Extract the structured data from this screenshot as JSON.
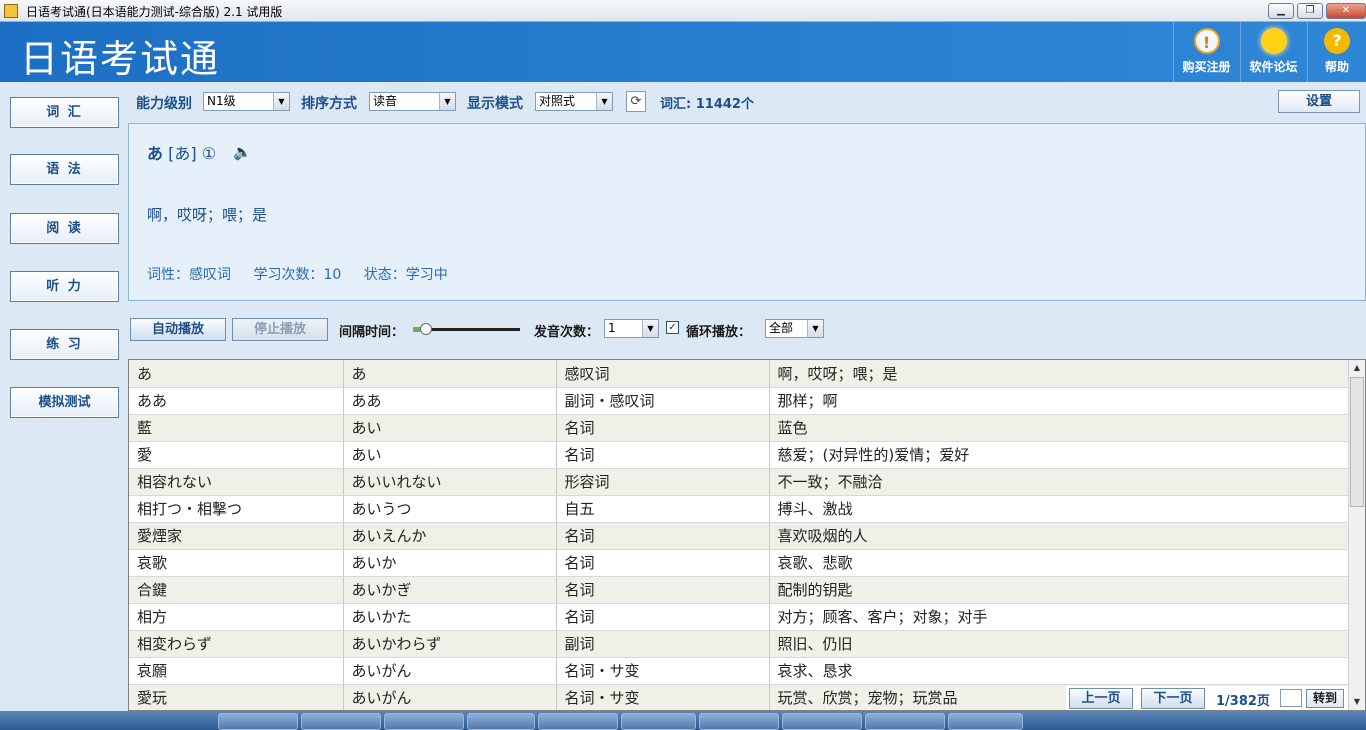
{
  "window": {
    "title": "日语考试通(日本语能力测试-综合版) 2.1 试用版",
    "buttons": {
      "minimize": "▁",
      "maximize": "❐",
      "close": "✕"
    }
  },
  "header": {
    "brand": "日语考试通",
    "buttons": [
      {
        "label": "购买注册",
        "icon": "register-icon",
        "glyph": "!"
      },
      {
        "label": "软件论坛",
        "icon": "lightbulb-icon",
        "glyph": "●"
      },
      {
        "label": "帮助",
        "icon": "help-icon",
        "glyph": "?"
      }
    ]
  },
  "sidebar": {
    "items": [
      {
        "label": "词  汇"
      },
      {
        "label": "语  法"
      },
      {
        "label": "阅  读"
      },
      {
        "label": "听  力"
      },
      {
        "label": "练  习"
      },
      {
        "label": "模拟测试"
      }
    ]
  },
  "toolbar": {
    "level_label": "能力级别",
    "level_value": "N1级",
    "sort_label": "排序方式",
    "sort_value": "读音",
    "mode_label": "显示模式",
    "mode_value": "对照式",
    "refresh_glyph": "⟳",
    "vocab_count": "词汇: 11442个",
    "settings_label": "设置"
  },
  "detail": {
    "word": "あ",
    "reading": "[あ]",
    "accent": "①",
    "speaker_glyph": "🔈",
    "meaning": "啊，哎呀；喂；是",
    "pos": "词性：感叹词",
    "study_count": "学习次数：10",
    "status": "状态：学习中"
  },
  "playback": {
    "auto_play": "自动播放",
    "stop_play": "停止播放",
    "interval_label": "间隔时间：",
    "interval_level": 0.12,
    "repeat_label": "发音次数：",
    "repeat_value": "1",
    "loop_checked_glyph": "✓",
    "loop_label": "循环播放：",
    "loop_value": "全部"
  },
  "words": [
    [
      "あ",
      "あ",
      "感叹词",
      "啊，哎呀；喂；是"
    ],
    [
      "ああ",
      "ああ",
      "副词・感叹词",
      "那样；啊"
    ],
    [
      "藍",
      "あい",
      "名词",
      "蓝色"
    ],
    [
      "愛",
      "あい",
      "名词",
      "慈爱；(对异性的)爱情；爱好"
    ],
    [
      "相容れない",
      "あいいれない",
      "形容词",
      "不一致；不融洽"
    ],
    [
      "相打つ・相撃つ",
      "あいうつ",
      "自五",
      "搏斗、激战"
    ],
    [
      "愛煙家",
      "あいえんか",
      "名词",
      "喜欢吸烟的人"
    ],
    [
      "哀歌",
      "あいか",
      "名词",
      "哀歌、悲歌"
    ],
    [
      "合鍵",
      "あいかぎ",
      "名词",
      "配制的钥匙"
    ],
    [
      "相方",
      "あいかた",
      "名词",
      "对方；顾客、客户；对象；对手"
    ],
    [
      "相変わらず",
      "あいかわらず",
      "副词",
      "照旧、仍旧"
    ],
    [
      "哀願",
      "あいがん",
      "名词・サ变",
      "哀求、恳求"
    ],
    [
      "愛玩",
      "あいがん",
      "名词・サ变",
      "玩赏、欣赏；宠物；玩赏品"
    ]
  ],
  "pager": {
    "prev": "上一页",
    "next": "下一页",
    "page_info": "1/382页",
    "go": "转到"
  }
}
